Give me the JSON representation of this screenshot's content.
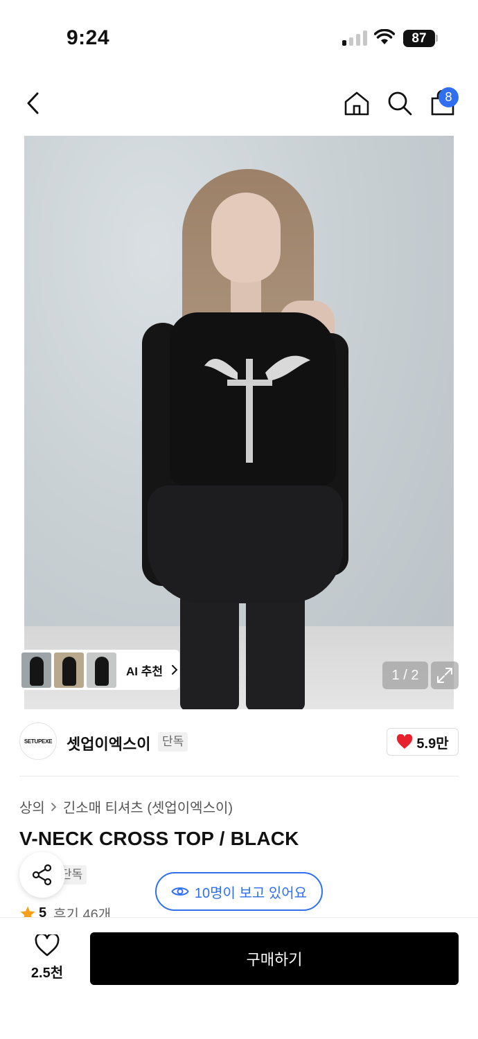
{
  "status_bar": {
    "time": "9:24",
    "battery": "87"
  },
  "header": {
    "cart_count": "8"
  },
  "gallery": {
    "counter": "1 / 2",
    "ai_recommend_label": "AI 추천"
  },
  "brand": {
    "logo_text": "SETUPEXE",
    "name": "셋업이엑스이",
    "badge": "단독",
    "likes": "5.9만"
  },
  "breadcrumb": {
    "category": "상의",
    "subcategory": "긴소매 티셔츠 (셋업이엑스이)"
  },
  "product": {
    "title": "V-NECK CROSS TOP / BLACK",
    "tag": "단독",
    "viewers": "10명이 보고 있어요"
  },
  "rating": {
    "score": "5",
    "reviews": "후기 46개"
  },
  "bottom_bar": {
    "wishlist_count": "2.5천",
    "buy_label": "구매하기"
  },
  "colors": {
    "accent_blue": "#2f6ff0",
    "heart_red": "#e8222d",
    "star_orange": "#f6a01a"
  },
  "icons": [
    "back-icon",
    "home-icon",
    "search-icon",
    "bag-icon",
    "expand-icon",
    "heart-icon",
    "share-icon",
    "eye-icon",
    "star-icon",
    "chevron-right-icon"
  ]
}
